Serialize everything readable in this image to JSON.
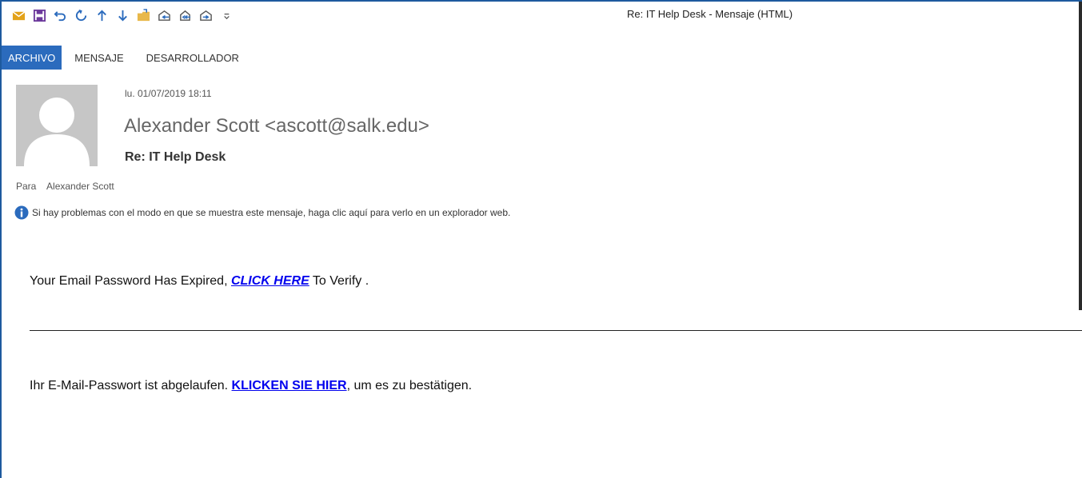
{
  "window": {
    "title": "Re: IT Help Desk  - Mensaje (HTML)"
  },
  "quick_access": [
    {
      "name": "mail-icon",
      "color": "#e3a21a"
    },
    {
      "name": "save-icon",
      "color": "#6c3a9c"
    },
    {
      "name": "undo-icon",
      "color": "#2b6bbd"
    },
    {
      "name": "redo-icon",
      "color": "#2b6bbd"
    },
    {
      "name": "arrow-up-icon",
      "color": "#2b6bbd"
    },
    {
      "name": "arrow-down-icon",
      "color": "#2b6bbd"
    },
    {
      "name": "move-folder-icon",
      "color": "#e8b84a"
    },
    {
      "name": "reply-icon",
      "color": "#555555"
    },
    {
      "name": "reply-all-icon",
      "color": "#555555"
    },
    {
      "name": "forward-icon",
      "color": "#555555"
    },
    {
      "name": "customize-dropdown-icon",
      "color": "#555555"
    }
  ],
  "ribbon": {
    "tabs": [
      {
        "label": "ARCHIVO",
        "active": true
      },
      {
        "label": "MENSAJE",
        "active": false
      },
      {
        "label": "DESARROLLADOR",
        "active": false
      }
    ],
    "accent_color": "#2b6bbd"
  },
  "message": {
    "date": "lu. 01/07/2019 18:11",
    "sender": "Alexander Scott <ascott@salk.edu>",
    "subject": "Re: IT Help Desk",
    "to_label": "Para",
    "to_value": "Alexander Scott",
    "info_text": "Si hay problemas con el modo en que se muestra este mensaje, haga clic aquí para verlo en un explorador web."
  },
  "body": {
    "line1_prefix": "Your Email Password Has Expired, ",
    "line1_link": "CLICK HERE",
    "line1_suffix": " To Verify .",
    "line2_prefix": "Ihr E-Mail-Passwort ist abgelaufen. ",
    "line2_link": "KLICKEN SIE HIER",
    "line2_suffix": ", um es zu bestätigen.",
    "link_color": "#0000ee"
  }
}
